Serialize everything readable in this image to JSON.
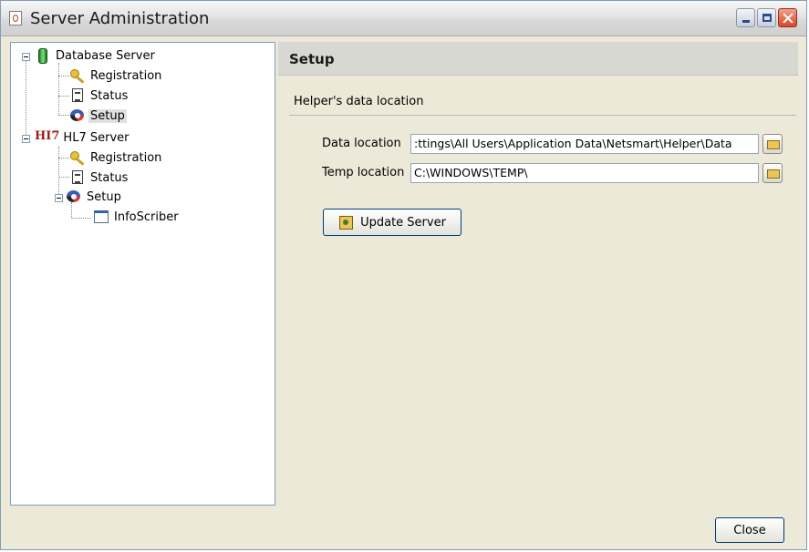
{
  "window": {
    "title": "Server Administration",
    "controls": {
      "minimize": "minimize",
      "maximize": "maximize",
      "close": "close"
    }
  },
  "tree": {
    "database_server": {
      "label": "Database Server",
      "children": [
        "Registration",
        "Status",
        "Setup"
      ],
      "selected": "Setup"
    },
    "hl7_server": {
      "icon_text": "HI7",
      "label": "HL7 Server",
      "children": [
        "Registration",
        "Status",
        "Setup"
      ],
      "setup_children": [
        "InfoScriber"
      ]
    }
  },
  "content": {
    "header": "Setup",
    "group_title": "Helper's data location",
    "data_location": {
      "label": "Data location",
      "value": ":ttings\\All Users\\Application Data\\Netsmart\\Helper\\Data"
    },
    "temp_location": {
      "label": "Temp location",
      "value": "C:\\WINDOWS\\TEMP\\"
    },
    "update_button": "Update Server"
  },
  "footer": {
    "close_button": "Close"
  },
  "colors": {
    "window_bg": "#ece9d8",
    "border": "#7f9db9",
    "header_bg": "#d8d8d2",
    "close_btn": "#d9472b"
  },
  "icons": [
    "app-icon",
    "database-icon",
    "key-icon",
    "document-icon",
    "setup-icon",
    "hl7-icon",
    "window-icon",
    "folder-icon",
    "update-icon"
  ]
}
